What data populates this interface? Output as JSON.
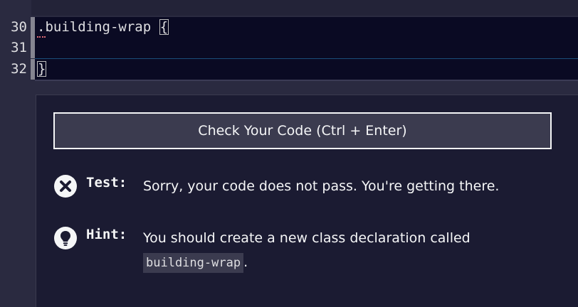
{
  "editor": {
    "lines": [
      {
        "number": "30",
        "text": ".building-wrap ",
        "brace": "{"
      },
      {
        "number": "31",
        "text": ""
      },
      {
        "number": "32",
        "text": "",
        "brace": "}"
      }
    ]
  },
  "panel": {
    "check_button_label": "Check Your Code (Ctrl + Enter)",
    "test": {
      "label": "Test:",
      "message": "Sorry, your code does not pass. You're getting there.",
      "icon": "fail-x-icon"
    },
    "hint": {
      "label": "Hint:",
      "message_prefix": "You should create a new class declaration called",
      "code": "building-wrap",
      "message_suffix": ".",
      "icon": "lightbulb-icon"
    }
  },
  "colors": {
    "background": "#2a2a40",
    "editor_bg": "#0a0a23",
    "panel_bg": "#1b1b32",
    "text": "#f5f6f7",
    "button_bg": "#3b3b4f"
  }
}
